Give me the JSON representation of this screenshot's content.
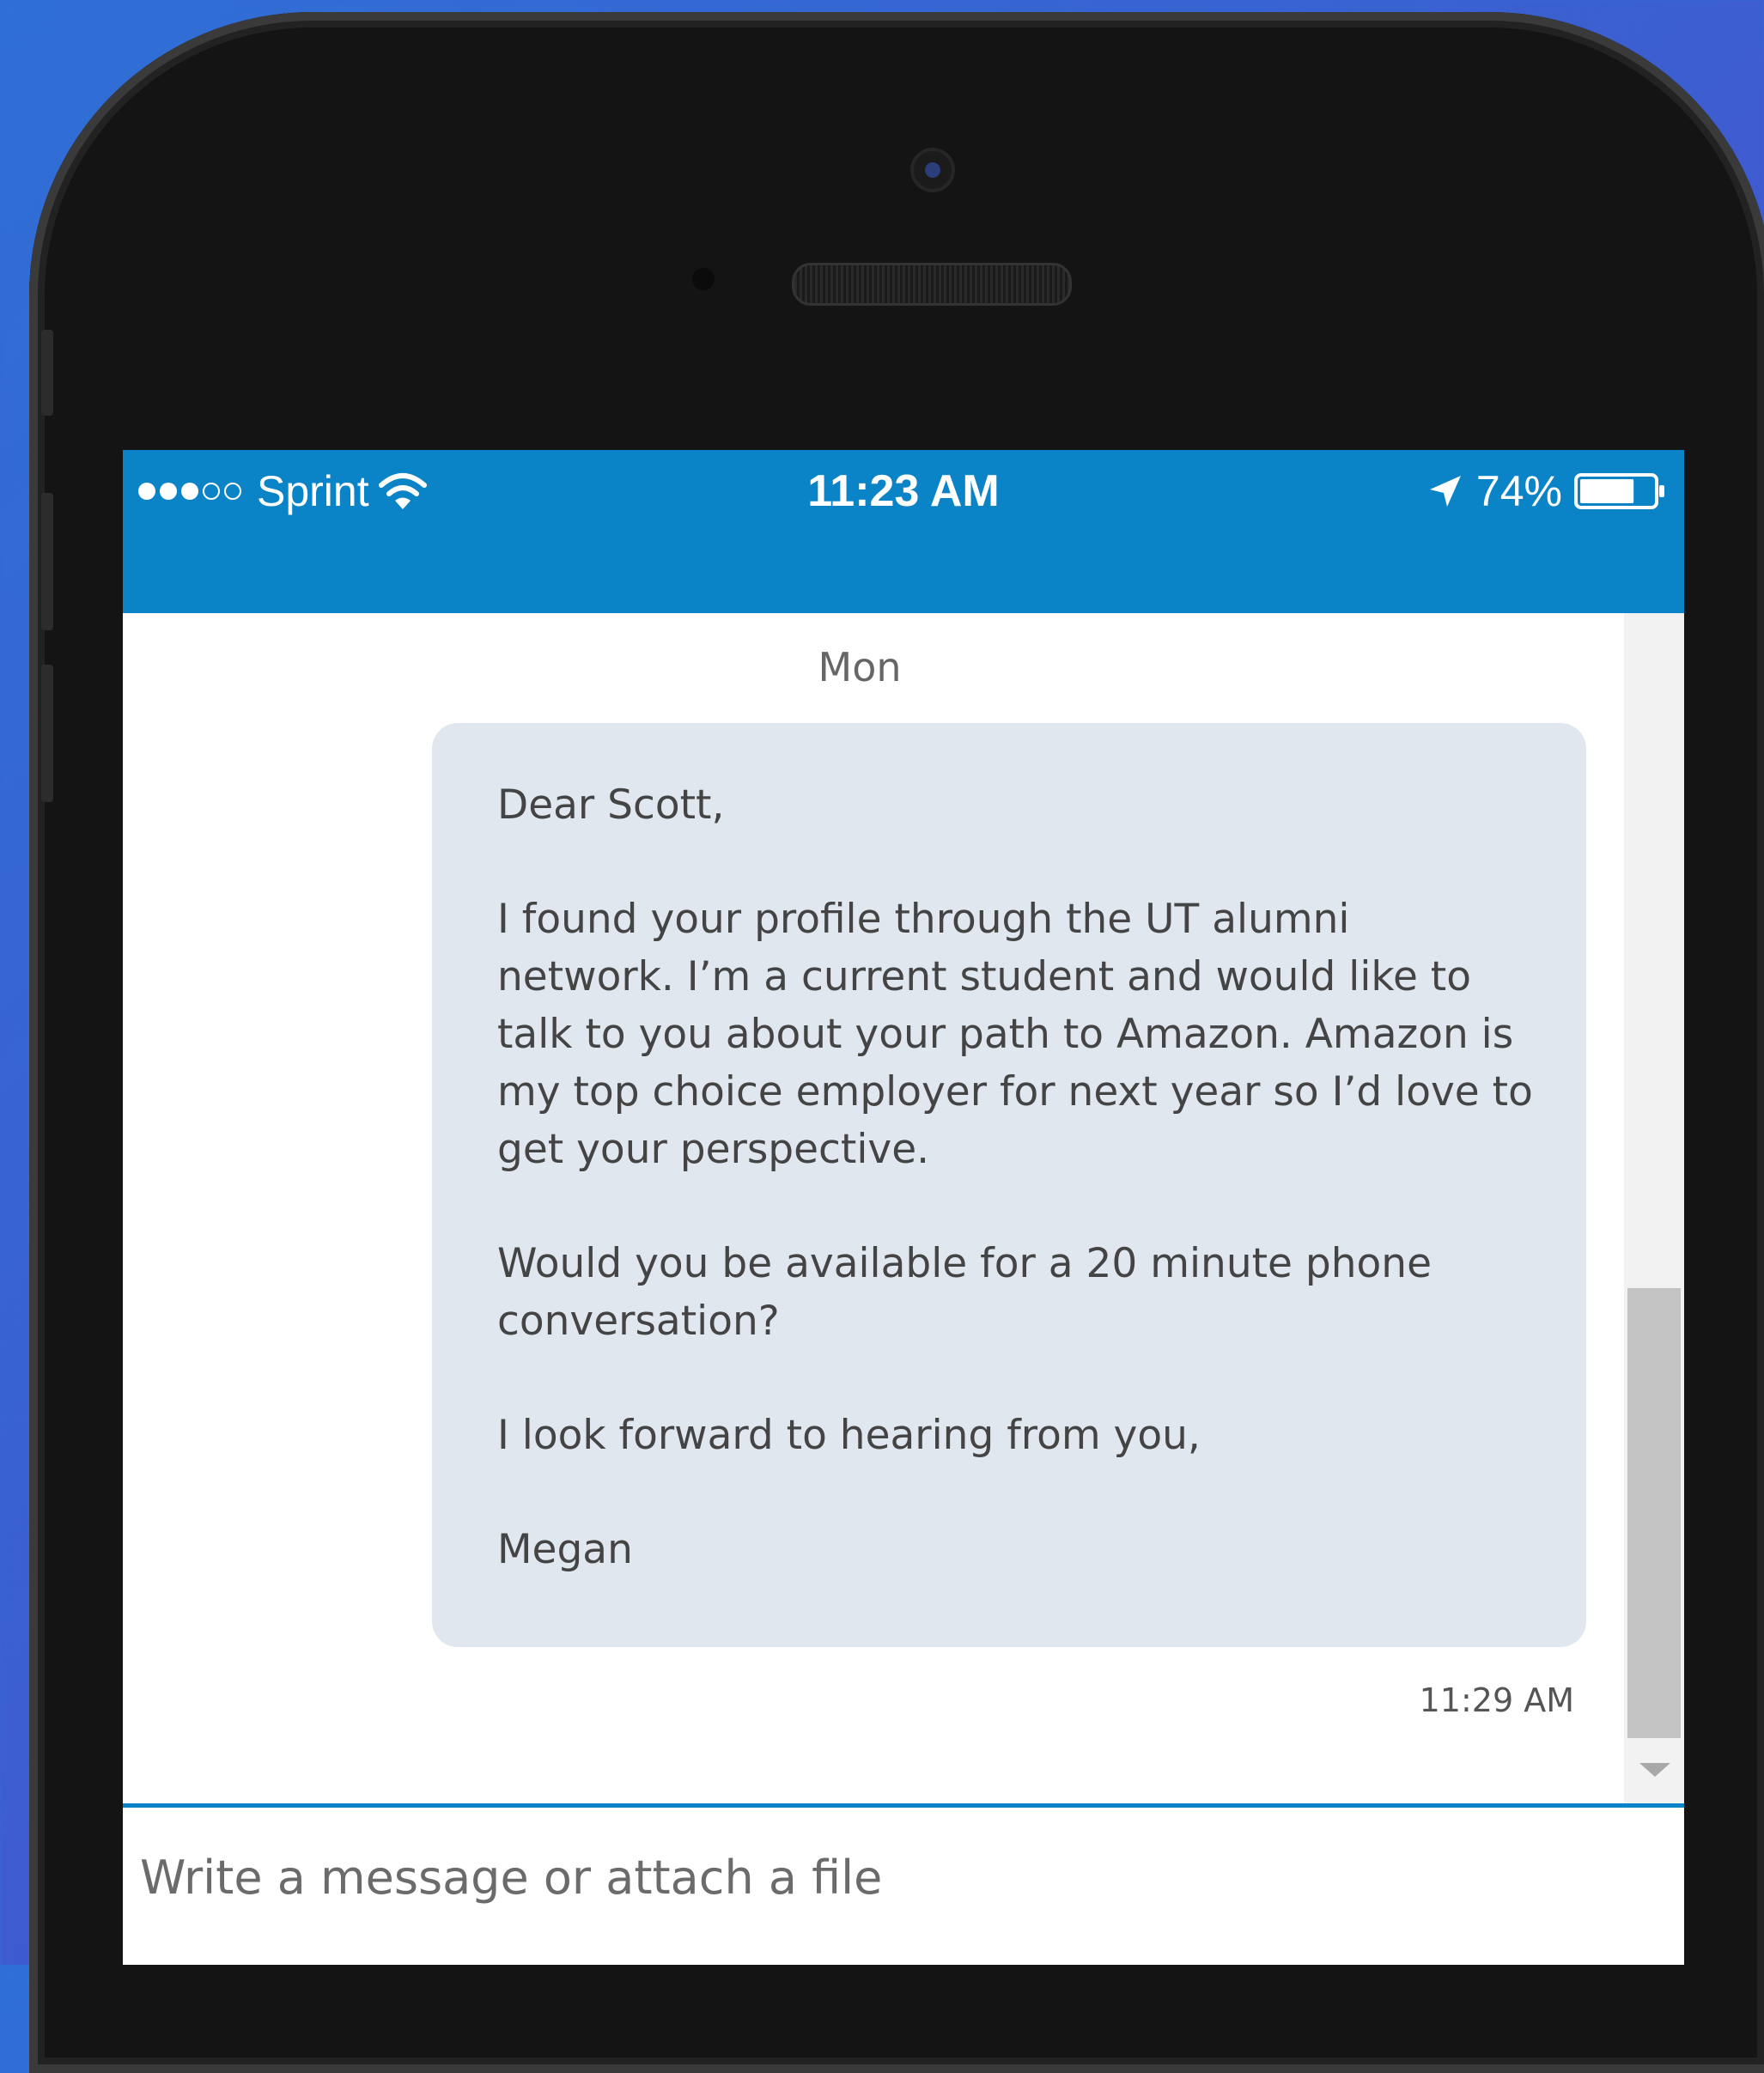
{
  "status_bar": {
    "signal_bars_filled": 3,
    "signal_bars_total": 5,
    "carrier": "Sprint",
    "time": "11:23 AM",
    "battery_percent": "74%",
    "battery_level": 0.74
  },
  "conversation": {
    "day_label": "Mon",
    "message": {
      "greeting": "Dear Scott,",
      "paragraph_1": "I found your profile through the UT alumni network. I’m a current student and would like to talk to you about your path to Amazon. Amazon is my top choice employer for next year so I’d love to get your perspective.",
      "paragraph_2": "Would you be available for a 20 minute phone conversation?",
      "closing": "I look forward to hearing from you,",
      "signature": "Megan",
      "timestamp": "11:29 AM"
    }
  },
  "composer": {
    "placeholder": "Write a message or attach a file"
  },
  "colors": {
    "header_blue": "#0a84c6",
    "bubble_bg": "#e1e7ee"
  },
  "icons": [
    "wifi-icon",
    "location-arrow-icon",
    "battery-icon"
  ]
}
